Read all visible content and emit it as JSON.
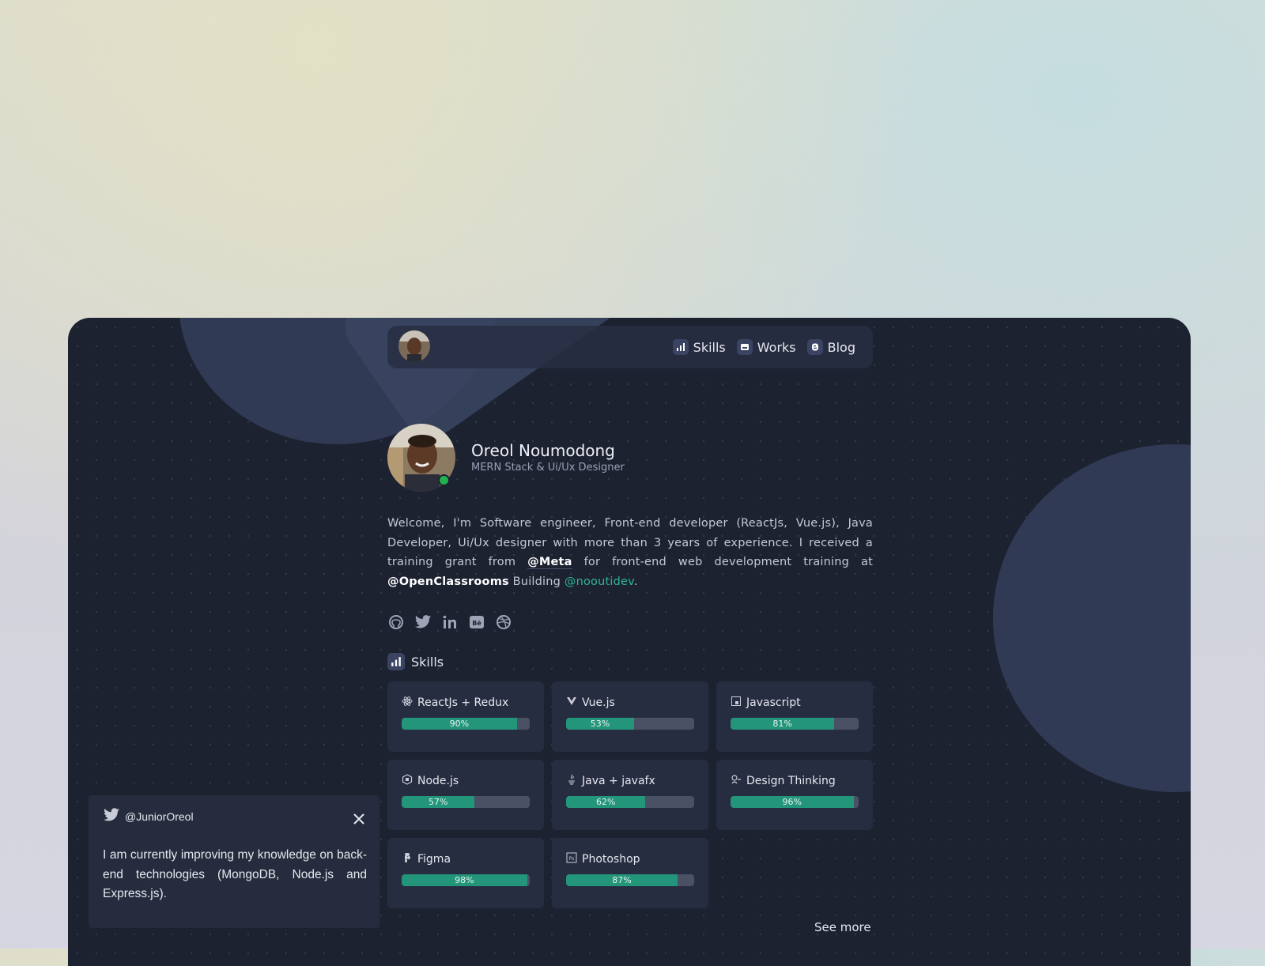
{
  "nav": {
    "links": [
      {
        "label": "Skills",
        "icon": "chart-bars-icon"
      },
      {
        "label": "Works",
        "icon": "briefcase-icon"
      },
      {
        "label": "Blog",
        "icon": "blogger-icon"
      }
    ]
  },
  "profile": {
    "name": "Oreol Noumodong",
    "role": "MERN Stack & Ui/Ux Designer",
    "status": "online"
  },
  "bio": {
    "text_1": "Welcome, I'm Software engineer, Front-end developer (ReactJs, Vue.js), Java Developer, Ui/Ux designer with more than 3 years of experience. I received a training grant from",
    "meta": "@Meta",
    "text_2": "for front-end web development training at",
    "openclassrooms": "@OpenClassrooms",
    "text_3": "Building",
    "nooutidev": "@nooutidev",
    "text_4": "."
  },
  "socials": [
    "github-icon",
    "twitter-icon",
    "linkedin-icon",
    "behance-icon",
    "dribbble-icon"
  ],
  "skills": {
    "title": "Skills",
    "items": [
      {
        "label": "ReactJs + Redux",
        "percent": 90,
        "percent_label": "90%",
        "icon": "react-icon"
      },
      {
        "label": "Vue.js",
        "percent": 53,
        "percent_label": "53%",
        "icon": "vue-icon"
      },
      {
        "label": "Javascript",
        "percent": 81,
        "percent_label": "81%",
        "icon": "javascript-icon"
      },
      {
        "label": "Node.js",
        "percent": 57,
        "percent_label": "57%",
        "icon": "nodejs-icon"
      },
      {
        "label": "Java + javafx",
        "percent": 62,
        "percent_label": "62%",
        "icon": "java-icon"
      },
      {
        "label": "Design Thinking",
        "percent": 96,
        "percent_label": "96%",
        "icon": "design-thinking-icon"
      },
      {
        "label": "Figma",
        "percent": 98,
        "percent_label": "98%",
        "icon": "figma-icon"
      },
      {
        "label": "Photoshop",
        "percent": 87,
        "percent_label": "87%",
        "icon": "photoshop-icon"
      }
    ],
    "see_more": "See more"
  },
  "tweet": {
    "handle": "@JuniorOreol",
    "text": "I am currently improving my knowledge on back-end technologies (MongoDB, Node.js and Express.js)."
  },
  "colors": {
    "accent": "#22957a",
    "link": "#2fb594",
    "background": "#1d2231",
    "online": "#22b14c"
  }
}
